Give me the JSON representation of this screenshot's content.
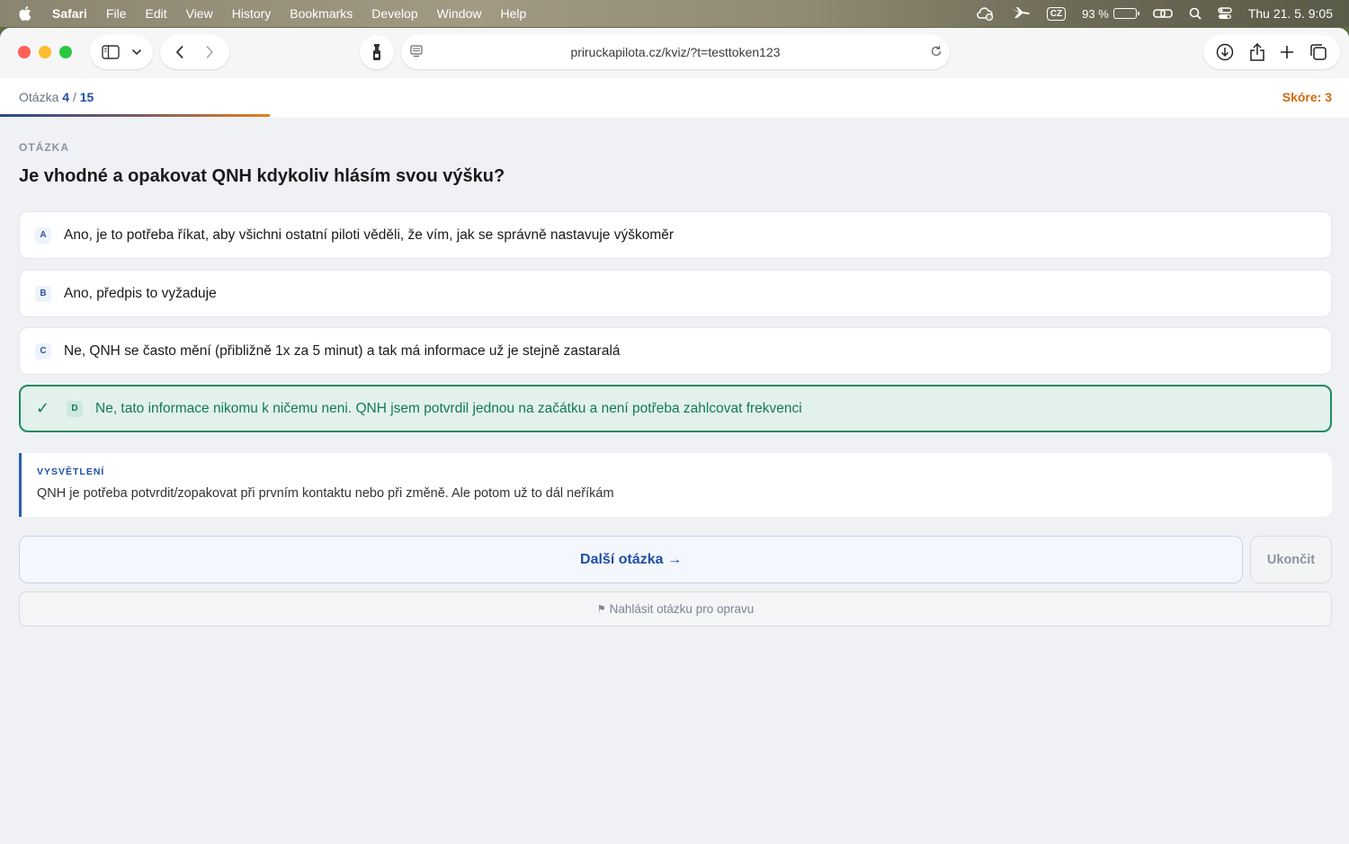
{
  "menubar": {
    "app": "Safari",
    "items": [
      "File",
      "Edit",
      "View",
      "History",
      "Bookmarks",
      "Develop",
      "Window",
      "Help"
    ],
    "keyboard": "CZ",
    "battery_percent": "93 %",
    "battery_level": 0.93,
    "clock": "Thu 21. 5.  9:05"
  },
  "browser": {
    "url": "priruckapilota.cz/kviz/?t=testtoken123"
  },
  "quiz": {
    "counter_prefix": "Otázka",
    "current": "4",
    "separator": "/",
    "total": "15",
    "progress": 0.2,
    "score_label": "Skóre: 3",
    "section_label": "OTÁZKA",
    "question": "Je vhodné a opakovat QNH kdykoliv hlásím svou výšku?",
    "options": [
      {
        "letter": "A",
        "text": "Ano, je to potřeba říkat, aby všichni ostatní piloti věděli, že vím, jak se správně nastavuje výškoměr",
        "correct": false
      },
      {
        "letter": "B",
        "text": "Ano, předpis to vyžaduje",
        "correct": false
      },
      {
        "letter": "C",
        "text": "Ne, QNH se často mění (přibližně 1x za 5 minut) a tak má informace už je stejně zastaralá",
        "correct": false
      },
      {
        "letter": "D",
        "text": "Ne, tato informace nikomu k ničemu neni. QNH jsem potvrdil jednou na začátku a není potřeba zahlcovat frekvenci",
        "correct": true
      }
    ],
    "check_mark": "✓",
    "explanation_title": "VYSVĚTLENÍ",
    "explanation_text": "QNH je potřeba potvrdit/zopakovat při prvním kontaktu nebo při změně. Ale potom už to dál neříkám",
    "next_label": "Další otázka →",
    "end_label": "Ukončit",
    "report_label": "Nahlásit otázku pro opravu",
    "report_flag": "⚑"
  },
  "colors": {
    "accent": "#1f4fa8",
    "score": "#d06a0d",
    "correct": "#127a52"
  }
}
